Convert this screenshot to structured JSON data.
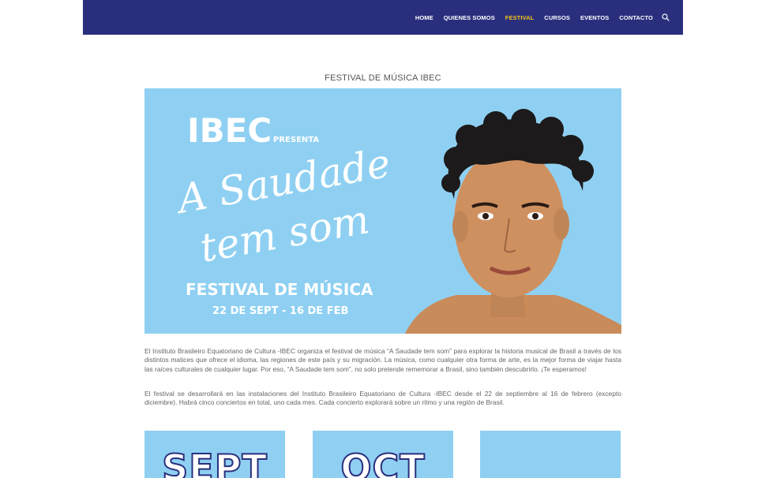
{
  "nav": {
    "items": [
      {
        "label": "HOME",
        "active": false
      },
      {
        "label": "QUIENES SOMOS",
        "active": false
      },
      {
        "label": "FESTIVAL",
        "active": true
      },
      {
        "label": "CURSOS",
        "active": false
      },
      {
        "label": "EVENTOS",
        "active": false
      },
      {
        "label": "CONTACTO",
        "active": false
      }
    ],
    "search_icon": "search-icon"
  },
  "page": {
    "title": "FESTIVAL DE MÚSICA IBEC"
  },
  "banner": {
    "brand": "IBEC",
    "presenta": "PRESENTA",
    "script_line1": "A Saudade",
    "script_line2": "tem som",
    "festival": "FESTIVAL DE MÚSICA",
    "dates": "22 DE SEPT - 16 DE FEB"
  },
  "content": {
    "paragraph1": "El Instituto Brasileiro Equatoriano de Cultura -IBEC organiza el festival de música “A Saudade tem som” para explorar la historia musical de Brasil a través de los distintos matices que ofrece el idioma, las regiones de este país y su migración. La música, como cualquier otra forma de arte, es la mejor forma de viajar hasta las raíces culturales de cualquier lugar. Por eso, “A Saudade tem som”, no solo pretende rememorar a Brasil, sino también descubrirlo. ¡Te esperamos!",
    "paragraph2": "El festival se desarrollará en las instalaciones del Instituto Brasileiro Equatoriano de Cultura -IBEC desde el 22 de septiembre al 16 de febrero (excepto diciembre). Habrá cinco conciertos en total, uno cada mes. Cada concierto explorará sobre un ritmo y una región de Brasil."
  },
  "cards": [
    {
      "label": "SEPT"
    },
    {
      "label": "OCT"
    },
    {
      "label": ""
    }
  ],
  "colors": {
    "header_bg": "#2a2f7d",
    "nav_active": "#f2c316",
    "banner_bg": "#8fd0f2"
  }
}
